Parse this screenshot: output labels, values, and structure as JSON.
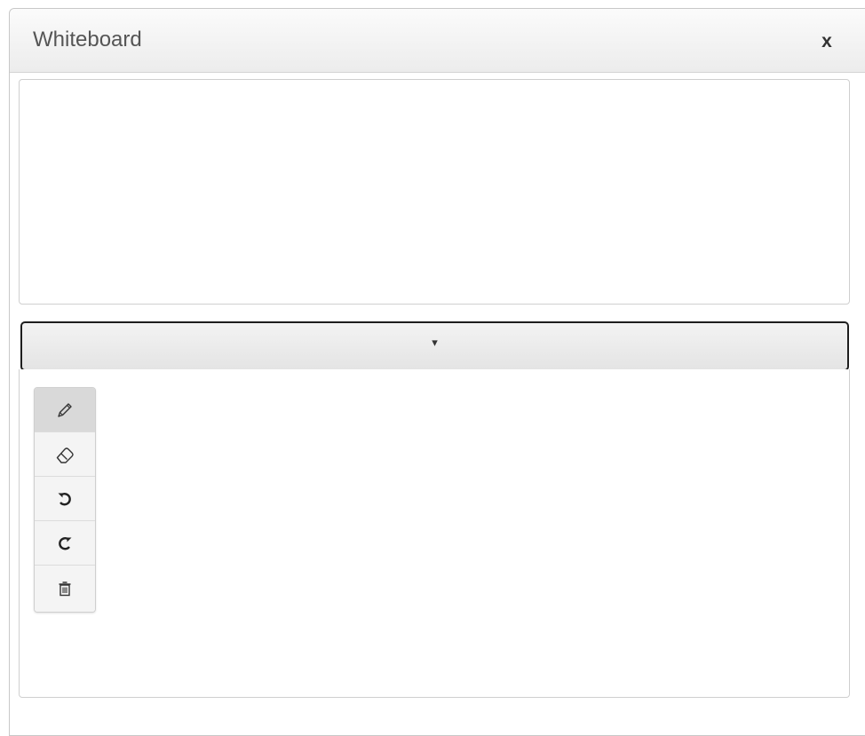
{
  "dialog": {
    "title": "Whiteboard",
    "close_label": "x"
  },
  "toggle": {
    "arrow": "▾"
  },
  "toolbar": {
    "tools": [
      {
        "name": "pen",
        "icon": "pencil-icon",
        "active": true
      },
      {
        "name": "eraser",
        "icon": "eraser-icon",
        "active": false
      },
      {
        "name": "undo",
        "icon": "undo-icon",
        "active": false
      },
      {
        "name": "redo",
        "icon": "redo-icon",
        "active": false
      },
      {
        "name": "clear",
        "icon": "trash-icon",
        "active": false
      }
    ]
  },
  "colors": {
    "titlebar_bg": "#efefef",
    "border": "#cfcfcf",
    "active_tool_bg": "#d9d9d9"
  }
}
